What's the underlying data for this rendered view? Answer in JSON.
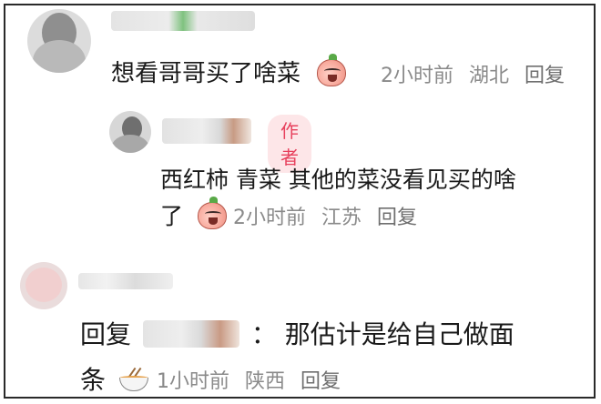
{
  "comments": [
    {
      "text": "想看哥哥买了啥菜",
      "time": "2小时前",
      "location": "湖北",
      "reply_label": "回复",
      "emoji": "peach-laugh-icon"
    },
    {
      "author_badge": "作者",
      "text_line1": "西红柿 青菜 其他的菜没看见买的啥",
      "text_line2": "了",
      "time": "2小时前",
      "location": "江苏",
      "reply_label": "回复",
      "emoji": "peach-laugh-icon"
    },
    {
      "reply_prefix": "回复",
      "separator": "：",
      "text_line1": "那估计是给自己做面",
      "text_line2": "条",
      "time": "1小时前",
      "location": "陕西",
      "reply_label": "回复",
      "emoji": "noodle-bowl-icon"
    }
  ],
  "colors": {
    "author_badge_bg": "#fde6e8",
    "author_badge_text": "#e7415d",
    "meta_text": "#8a8a8a"
  }
}
